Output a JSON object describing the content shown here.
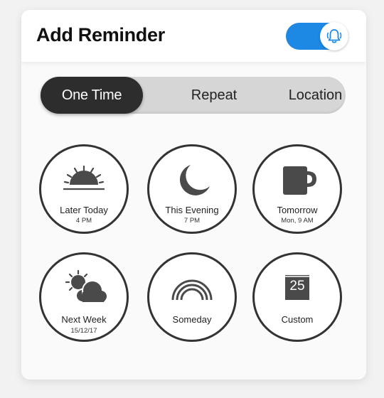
{
  "header": {
    "title": "Add Reminder",
    "toggle_on": true,
    "toggle_icon": "bell-ringing-icon",
    "accent_color": "#1e88e5"
  },
  "tabs": [
    {
      "label": "One Time",
      "active": true
    },
    {
      "label": "Repeat",
      "active": false
    },
    {
      "label": "Location",
      "active": false
    }
  ],
  "options": [
    {
      "label": "Later Today",
      "sublabel": "4 PM",
      "icon": "sunset-icon"
    },
    {
      "label": "This Evening",
      "sublabel": "7 PM",
      "icon": "moon-icon"
    },
    {
      "label": "Tomorrow",
      "sublabel": "Mon, 9 AM",
      "icon": "coffee-mug-icon"
    },
    {
      "label": "Next Week",
      "sublabel": "15/12/17",
      "icon": "sun-cloud-icon"
    },
    {
      "label": "Someday",
      "sublabel": "",
      "icon": "rainbow-icon"
    },
    {
      "label": "Custom",
      "sublabel": "",
      "icon": "calendar-icon",
      "calendar_day": "25"
    }
  ]
}
